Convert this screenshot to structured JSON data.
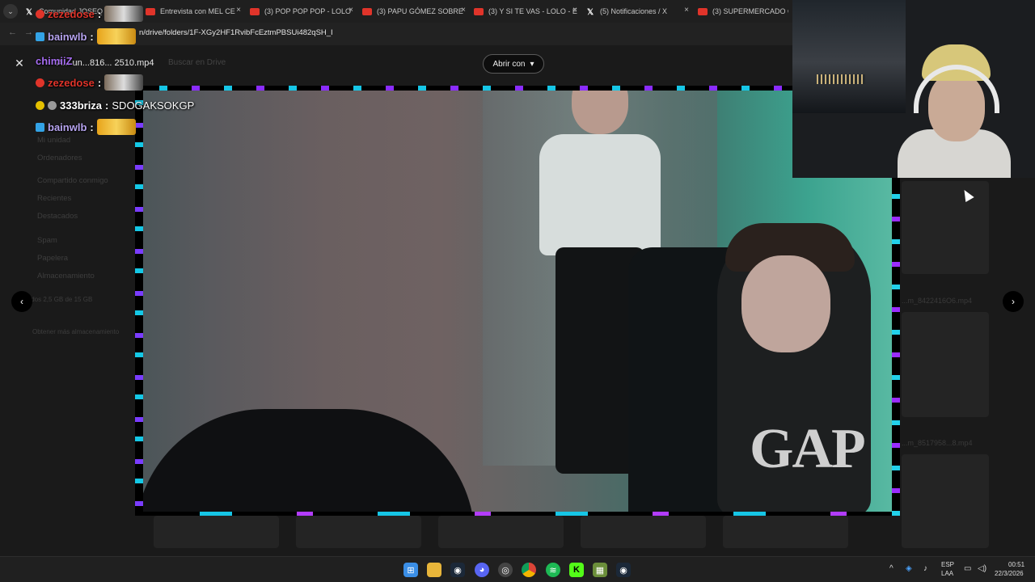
{
  "browser": {
    "url": "n/drive/folders/1F-XGy2HF1RvibFcEztmPBSUi482qSH_I",
    "tabs": [
      {
        "label": "Comunidad JOSEQ",
        "icon": "x-icon"
      },
      {
        "label": "Entrevista con MEL CE",
        "icon": "youtube-icon"
      },
      {
        "label": "(3) POP POP POP - LOLO",
        "icon": "youtube-icon"
      },
      {
        "label": "(3) PAPU GÓMEZ SOBRE",
        "icon": "youtube-icon"
      },
      {
        "label": "(3) Y SI TE VAS - LOLO - E",
        "icon": "youtube-icon"
      },
      {
        "label": "(5) Notificaciones / X",
        "icon": "x-icon"
      },
      {
        "label": "(3) SUPERMERCADO CHI",
        "icon": "youtube-icon"
      }
    ],
    "tab_close": "×"
  },
  "viewer": {
    "file_title": "A... un...816... 2510.mp4",
    "open_with_label": "Abrir con",
    "close_glyph": "✕",
    "prev_glyph": "‹",
    "next_glyph": "›"
  },
  "drive_bg": {
    "search_placeholder": "Buscar en Drive",
    "sidebar": [
      "Mi unidad",
      "Ordenadores",
      "Compartido conmigo",
      "Recientes",
      "Destacados",
      "Spam",
      "Papelera",
      "Almacenamiento"
    ],
    "storage_text": "Usados 2,5 GB de 15 GB",
    "storage_button": "Obtener más almacenamiento",
    "thumbs": [
      "...m_8422416O6.mp4",
      "...m_8517958...8.mp4"
    ]
  },
  "chat": [
    {
      "user": "zezedose",
      "color": "#e0342a",
      "badge_color": "#e0342a",
      "message": "",
      "emote": true
    },
    {
      "user": "bainwlb",
      "color": "#b7a4f0",
      "badge_color": "#33a3e6",
      "message": "",
      "emote": true
    },
    {
      "user": "chimiiZ",
      "color": "#a56cf0",
      "badge_color": "",
      "message": "",
      "emote": false
    },
    {
      "user": "zezedose",
      "color": "#e0342a",
      "badge_color": "#e0342a",
      "message": "",
      "emote": true
    },
    {
      "user": "333briza",
      "color": "#ffffff",
      "badge_color": "#e5c000",
      "message": "SDOGAKSOKGP",
      "emote": false
    },
    {
      "user": "bainwlb",
      "color": "#b7a4f0",
      "badge_color": "#33a3e6",
      "message": "",
      "emote": true
    }
  ],
  "taskbar": {
    "apps": [
      "windows-start-icon",
      "file-explorer-icon",
      "steam-icon",
      "discord-icon",
      "obs-icon",
      "chrome-icon",
      "spotify-icon",
      "kick-icon",
      "minecraft-icon",
      "steam-icon"
    ],
    "lang_top": "ESP",
    "lang_bottom": "LAA",
    "time": "00:51",
    "date": "22/3/2026"
  },
  "colors": {
    "accent_neon_cyan": "#16c6e6",
    "accent_neon_purple": "#8a2cff"
  }
}
